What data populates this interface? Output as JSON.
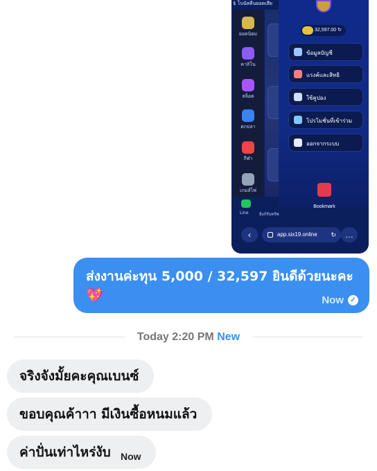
{
  "screenshot": {
    "top_label": "$ โบนัสคืนยอดเสีย",
    "side_menu": [
      {
        "label": "ยอดนิยม",
        "icon": "star-icon",
        "color": "#d9b64a"
      },
      {
        "label": "คาสิโน",
        "icon": "cards-icon",
        "color": "#8b5cf6"
      },
      {
        "label": "สล็อต",
        "icon": "slot-icon",
        "color": "#a855f7"
      },
      {
        "label": "ตกปลา",
        "icon": "fish-icon",
        "color": "#3b82f6"
      },
      {
        "label": "กีฬา",
        "icon": "ball-icon",
        "color": "#ef4444"
      },
      {
        "label": "เกมส์ไพ่",
        "icon": "dice-icon",
        "color": "#94a3b8"
      }
    ],
    "balance": "32,597.00",
    "menu_items": [
      {
        "label": "ข้อมูลบัญชี",
        "icon": "user-icon",
        "color": "#9ec5ff"
      },
      {
        "label": "แรงค์และสิทธิ",
        "icon": "medal-icon",
        "color": "#f08080"
      },
      {
        "label": "ใช้คูปอง",
        "icon": "coupon-icon",
        "color": "#cfe0ff"
      },
      {
        "label": "โปรโมชั่นที่เข้าร่วม",
        "icon": "gift-icon",
        "color": "#7ec8ff"
      },
      {
        "label": "ออกจากระบบ",
        "icon": "logout-icon",
        "color": "#e8ecff"
      }
    ],
    "bookmark_label": "Bookmark",
    "line_label": "Line",
    "line_extra": "ลิงก์รับทรัพ",
    "url": "app.six19.online"
  },
  "chat": {
    "sent_text": "ส่งงานค่ะทุน 5,000 / 32,597 ยินดีด้วยนะคะ",
    "sent_emoji": "💖",
    "sent_status": "Now",
    "divider_time": "Today 2:20 PM",
    "divider_new": "New",
    "received": [
      {
        "text": "จริงจังมั้ยคะคุณเบนซ์",
        "meta": ""
      },
      {
        "text": "ขอบคุณค้าาา มีเงินซื้อหนมแล้ว",
        "meta": ""
      },
      {
        "text": "ค่าปั่นเท่าไหร่งับ",
        "meta": "Now"
      }
    ]
  },
  "colors": {
    "sent_bubble": "#3a8ff0",
    "received_bubble": "#eeeff1",
    "screenshot_bg": "#0b1f5c"
  }
}
